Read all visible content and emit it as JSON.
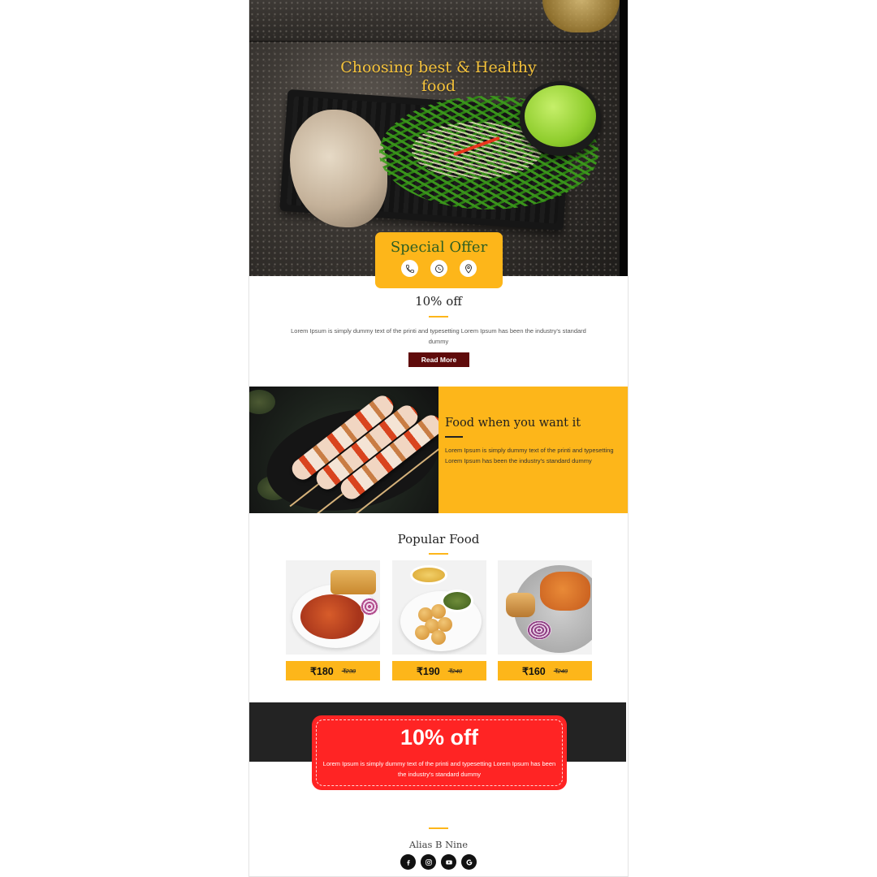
{
  "hero": {
    "title": "Choosing best & Healthy food"
  },
  "special_offer": {
    "title": "Special Offer",
    "icons": [
      "phone-icon",
      "whatsapp-icon",
      "location-pin-icon"
    ]
  },
  "offer": {
    "title": "10% off",
    "description": "Lorem Ipsum is simply dummy text of the printi and typesetting Lorem Ipsum has been the industry's standard dummy",
    "button_label": "Read More"
  },
  "feature": {
    "title": "Food when you want it",
    "description": "Lorem Ipsum is simply dummy text of the printi and typesetting Lorem Ipsum has been the industry's standard dummy"
  },
  "popular": {
    "title": "Popular Food",
    "items": [
      {
        "price": "₹180",
        "old_price": "₹230"
      },
      {
        "price": "₹190",
        "old_price": "₹240"
      },
      {
        "price": "₹160",
        "old_price": "₹240"
      }
    ]
  },
  "coupon": {
    "title": "10% off",
    "description": "Lorem Ipsum is simply dummy text of the printi and typesetting Lorem Ipsum has been the industry's standard dummy"
  },
  "footer": {
    "brand": "Alias B Nine",
    "social_icons": [
      "facebook-icon",
      "instagram-icon",
      "youtube-icon",
      "google-icon"
    ]
  },
  "colors": {
    "accent_yellow": "#fdb61a",
    "button_maroon": "#5f0b0b",
    "coupon_red": "#ff2424",
    "dark_band": "#232323"
  }
}
